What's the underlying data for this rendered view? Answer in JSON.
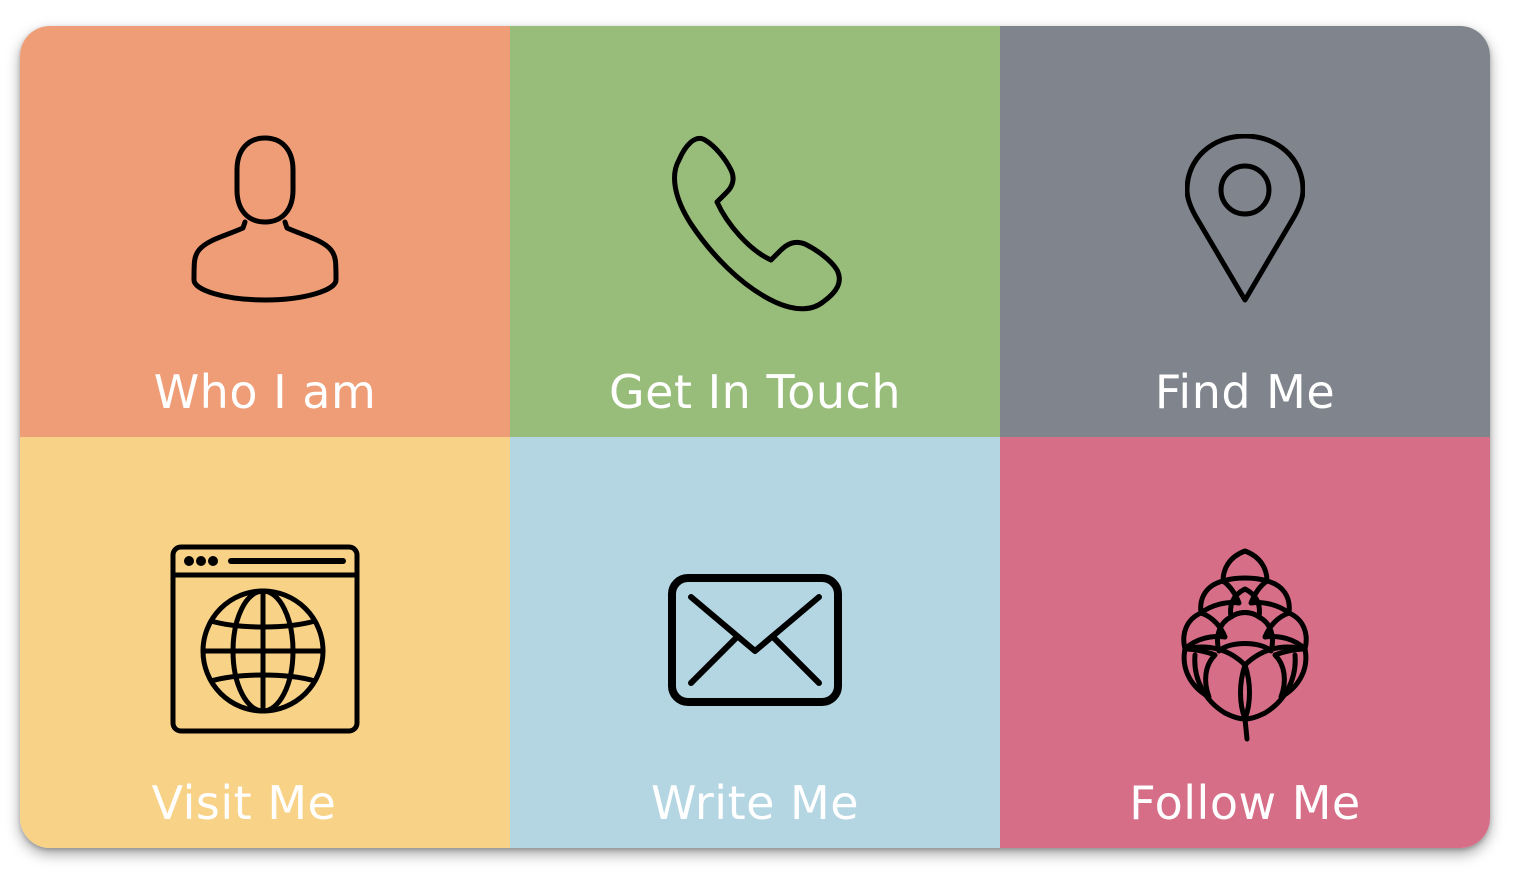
{
  "tiles": [
    {
      "label": "Who I am",
      "color": "#EE9D77",
      "icon": "user-icon"
    },
    {
      "label": "Get In Touch",
      "color": "#98BC79",
      "icon": "phone-icon"
    },
    {
      "label": "Find Me",
      "color": "#80858D",
      "icon": "location-pin-icon"
    },
    {
      "label": "Visit Me",
      "color": "#F8D287",
      "icon": "web-globe-icon"
    },
    {
      "label": "Write Me",
      "color": "#B4D5E2",
      "icon": "envelope-icon"
    },
    {
      "label": "Follow Me",
      "color": "#D66E88",
      "icon": "hop-icon"
    }
  ]
}
